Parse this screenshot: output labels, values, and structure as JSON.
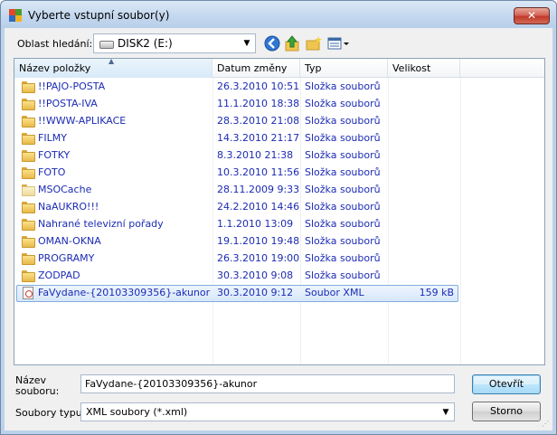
{
  "window": {
    "title": "Vyberte vstupní soubor(y)",
    "close_glyph": "✕"
  },
  "toolbar": {
    "lookin_label": "Oblast hledání:",
    "lookin_value": "DISK2 (E:)",
    "icons": [
      "back-icon",
      "up-folder-icon",
      "new-folder-icon",
      "view-menu-icon"
    ]
  },
  "columns": {
    "name": "Název položky",
    "date": "Datum změny",
    "type": "Typ",
    "size": "Velikost"
  },
  "files": [
    {
      "name": "!!PAJO-POSTA",
      "date": "26.3.2010 10:51",
      "type": "Složka souborů",
      "size": "",
      "kind": "folder"
    },
    {
      "name": "!!POSTA-IVA",
      "date": "11.1.2010 18:38",
      "type": "Složka souborů",
      "size": "",
      "kind": "folder"
    },
    {
      "name": "!!WWW-APLIKACE",
      "date": "28.3.2010 21:08",
      "type": "Složka souborů",
      "size": "",
      "kind": "folder"
    },
    {
      "name": "FILMY",
      "date": "14.3.2010 21:17",
      "type": "Složka souborů",
      "size": "",
      "kind": "folder"
    },
    {
      "name": "FOTKY",
      "date": "8.3.2010 21:38",
      "type": "Složka souborů",
      "size": "",
      "kind": "folder"
    },
    {
      "name": "FOTO",
      "date": "10.3.2010 11:56",
      "type": "Složka souborů",
      "size": "",
      "kind": "folder"
    },
    {
      "name": "MSOCache",
      "date": "28.11.2009 9:33",
      "type": "Složka souborů",
      "size": "",
      "kind": "folder-hidden"
    },
    {
      "name": "NaAUKRO!!!",
      "date": "24.2.2010 14:46",
      "type": "Složka souborů",
      "size": "",
      "kind": "folder"
    },
    {
      "name": "Nahrané televizní pořady",
      "date": "1.1.2010 13:09",
      "type": "Složka souborů",
      "size": "",
      "kind": "folder"
    },
    {
      "name": "OMAN-OKNA",
      "date": "19.1.2010 19:48",
      "type": "Složka souborů",
      "size": "",
      "kind": "folder"
    },
    {
      "name": "PROGRAMY",
      "date": "26.3.2010 19:00",
      "type": "Složka souborů",
      "size": "",
      "kind": "folder"
    },
    {
      "name": "ZODPAD",
      "date": "30.3.2010 9:08",
      "type": "Složka souborů",
      "size": "",
      "kind": "folder"
    },
    {
      "name": "FaVydane-{20103309356}-akunor",
      "date": "30.3.2010 9:12",
      "type": "Soubor XML",
      "size": "159 kB",
      "kind": "xml",
      "selected": true
    }
  ],
  "footer": {
    "filename_label_line1": "Název",
    "filename_label_line2": "souboru:",
    "filename_value": "FaVydane-{20103309356}-akunor",
    "filetype_label": "Soubory typu:",
    "filetype_value": "XML soubory (*.xml)",
    "open_button": "Otevřít",
    "cancel_button": "Storno"
  }
}
